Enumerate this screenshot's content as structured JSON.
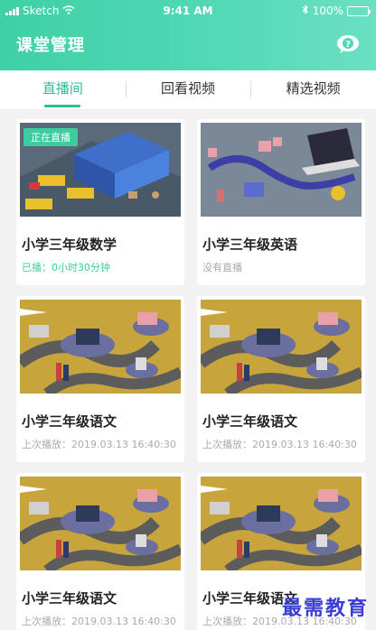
{
  "status_bar": {
    "carrier": "Sketch",
    "time": "9:41 AM",
    "battery": "100%",
    "battery_level": 1.0
  },
  "header": {
    "title": "课堂管理",
    "help_icon": "question-bubble-icon"
  },
  "tabs": [
    {
      "label": "直播间",
      "active": true
    },
    {
      "label": "回看视频",
      "active": false
    },
    {
      "label": "精选视频",
      "active": false
    }
  ],
  "cards": [
    {
      "badge": "正在直播",
      "title": "小学三年级数学",
      "subtitle": "已播：0小时30分钟",
      "live": true,
      "image": "warehouse-trucks"
    },
    {
      "badge": "",
      "title": "小学三年级英语",
      "subtitle": "没有直播",
      "live": false,
      "image": "logistics-laptop"
    },
    {
      "badge": "",
      "title": "小学三年级语文",
      "subtitle": "上次播放：2019.03.13 16:40:30",
      "live": false,
      "image": "delivery-road"
    },
    {
      "badge": "",
      "title": "小学三年级语文",
      "subtitle": "上次播放：2019.03.13 16:40:30",
      "live": false,
      "image": "delivery-road"
    },
    {
      "badge": "",
      "title": "小学三年级语文",
      "subtitle": "上次播放：2019.03.13 16:40:30",
      "live": false,
      "image": "delivery-road"
    },
    {
      "badge": "",
      "title": "小学三年级语文",
      "subtitle": "上次播放：2019.03.13 16:40:30",
      "live": false,
      "image": "delivery-road"
    }
  ],
  "watermark": "最需教育",
  "colors": {
    "accent": "#2bbf93",
    "header_start": "#3fd0a6",
    "header_end": "#6be0c2",
    "badge": "#3ecb9f"
  }
}
